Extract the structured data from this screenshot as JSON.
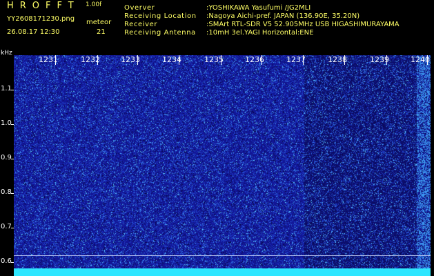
{
  "header": {
    "brand": "HROFFT",
    "version": "1.00f",
    "filename": "YY2608171230.png",
    "datetime": "26.08.17 12:30",
    "mode_label": "meteor",
    "count": "21"
  },
  "station": {
    "rows": [
      {
        "label": "Overver",
        "value": ":YOSHIKAWA Yasufumi /JG2MLI"
      },
      {
        "label": "Receiving Location",
        "value": ":Nagoya Aichi-pref. JAPAN (136.90E, 35.20N)"
      },
      {
        "label": "Receiver",
        "value": ":SMArt RTL-SDR V5 52.905MHz USB HIGASHIMURAYAMA"
      },
      {
        "label": "Receiving Antenna",
        "value": ":10mH 3el.YAGI Horizontal:ENE"
      }
    ]
  },
  "spectrogram": {
    "y_unit": "kHz",
    "y_ticks": [
      "1.1",
      "1.0",
      "0.9",
      "0.8",
      "0.7",
      "0.6"
    ],
    "x_ticks": [
      "1231",
      "1232",
      "1233",
      "1234",
      "1235",
      "1236",
      "1237",
      "1238",
      "1239",
      "1240"
    ],
    "colors": {
      "background": "#000000",
      "text": "#ffff66",
      "axis": "#ffffff",
      "noise_low": "#1a1aa0",
      "noise_high": "#6fd0ff",
      "baseline": "#2ee6ff"
    }
  }
}
